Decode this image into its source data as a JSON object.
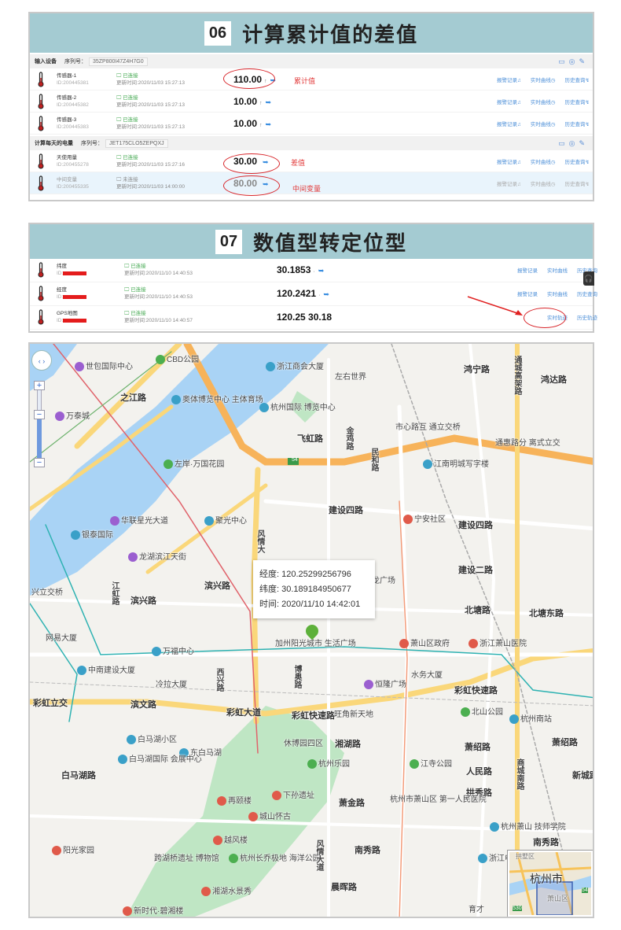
{
  "section1": {
    "number": "06",
    "title": "计算累计值的差值",
    "groups": [
      {
        "name": "输入设备",
        "serial_label": "序列号：",
        "serial": "35ZP800I47Z4H7G0",
        "rows": [
          {
            "name": "传感器-1",
            "id": "ID:200445381",
            "status": "已连接",
            "updated": "更新时间:2020/11/03 15:27:13",
            "value": "110.00",
            "trend": "↑"
          },
          {
            "name": "传感器-2",
            "id": "ID:200445382",
            "status": "已连接",
            "updated": "更新时间:2020/11/03 15:27:13",
            "value": "10.00",
            "trend": "↑"
          },
          {
            "name": "传感器-3",
            "id": "ID:200445383",
            "status": "已连接",
            "updated": "更新时间:2020/11/03 15:27:13",
            "value": "10.00",
            "trend": "↑"
          }
        ]
      },
      {
        "name": "计算每天的电量",
        "serial_label": "序列号：",
        "serial": "JET175CLO5ZEPQXJ",
        "rows": [
          {
            "name": "天使用量",
            "id": "ID:200455278",
            "status": "已连接",
            "updated": "更新时间:2020/11/03 15:27:16",
            "value": "30.00",
            "trend": ""
          },
          {
            "name": "中间变量",
            "id": "ID:200455335",
            "status": "未连接",
            "updated": "更新时间:2020/11/03 14:00:00",
            "value": "80.00",
            "trend": ""
          }
        ]
      }
    ],
    "annotations": {
      "cumulative": "累计值",
      "difference": "差值",
      "intermediate": "中间变量"
    },
    "links": {
      "alarm": "报警记录",
      "realtime": "实时曲线",
      "history": "历史查询"
    }
  },
  "section2": {
    "number": "07",
    "title": "数值型转定位型",
    "rows": [
      {
        "name": "纬度",
        "id": "ID:",
        "status": "已连接",
        "updated": "更新时间:2020/11/10 14:40:53",
        "value": "30.1853",
        "link1": "报警记录",
        "link2": "实时曲线",
        "link3": "历史查询"
      },
      {
        "name": "经度",
        "id": "ID:",
        "status": "已连接",
        "updated": "更新时间:2020/11/10 14:40:53",
        "value": "120.2421",
        "link1": "报警记录",
        "link2": "实时曲线",
        "link3": "历史查询"
      },
      {
        "name": "GPS地图",
        "id": "ID:",
        "status": "已连接",
        "updated": "更新时间:2020/11/10 14:40:57",
        "value": "120.25 30.18",
        "link2": "实时轨迹",
        "link3": "历史轨迹"
      }
    ]
  },
  "map": {
    "popup": {
      "lng": "经度: 120.25299256796",
      "lat": "纬度: 30.189184950677",
      "time": "时间: 2020/11/10 14:42:01"
    },
    "minimap": {
      "city": "杭州市",
      "district": "萧山区",
      "north": "拱墅区",
      "shield1": "54",
      "shield2": "530"
    },
    "shield": "54",
    "labels": [
      "世包国际中心",
      "CBD公园",
      "浙江商会大厦",
      "左右世界",
      "鸿宁路",
      "通城高架路",
      "鸿达路",
      "之江路",
      "奥体博览中心 主体育场",
      "杭州国际 博览中心",
      "万泰城",
      "飞虹路",
      "金鸡路",
      "市心路互 通立交桥",
      "通惠路分 离式立交",
      "民和路",
      "江南明城写字楼",
      "左岸·万国花园",
      "建设四路",
      "宁安社区",
      "建设四路",
      "华联星光大道",
      "聚光中心",
      "银泰国际",
      "风情大",
      "龙湖滨江天街",
      "滨兴路",
      "江虹路",
      "滨兴路",
      "兴立交桥",
      "建设二路",
      "龙广场",
      "北塘路",
      "北塘东路",
      "网易大厦",
      "万福中心",
      "萧山区政府",
      "浙江萧山医院",
      "加州阳光城市 生活广场",
      "中南建设大厦",
      "冷拉大厦",
      "西兴路",
      "博奥路",
      "恒隆广场",
      "水务大厦",
      "彩虹快速路",
      "彩虹立交",
      "滨文路",
      "彩虹大道",
      "彩虹快速路",
      "旺角新天地",
      "北山公园",
      "杭州南站",
      "白马湖小区",
      "休博园四区",
      "湘湖路",
      "萧绍路",
      "萧绍路",
      "东白马湖",
      "白马湖国际 会展中心",
      "杭州乐园",
      "江寺公园",
      "人民路",
      "商城南路",
      "白马湖路",
      "拱秀路",
      "再颐楼",
      "下孙遗址",
      "城山怀古",
      "萧金路",
      "杭州市萧山区 第一人民医院",
      "杭州萧山 技师学院",
      "越风楼",
      "南秀路",
      "阳光家园",
      "南秀路",
      "跨湖桥遗址 博物馆",
      "杭州长乔极地 海洋公园",
      "浙江电大 萧山学院",
      "风情大道",
      "湘湖水景秀",
      "晨晖路",
      "新时代·碧湘楼",
      "育才",
      "新城路"
    ]
  }
}
